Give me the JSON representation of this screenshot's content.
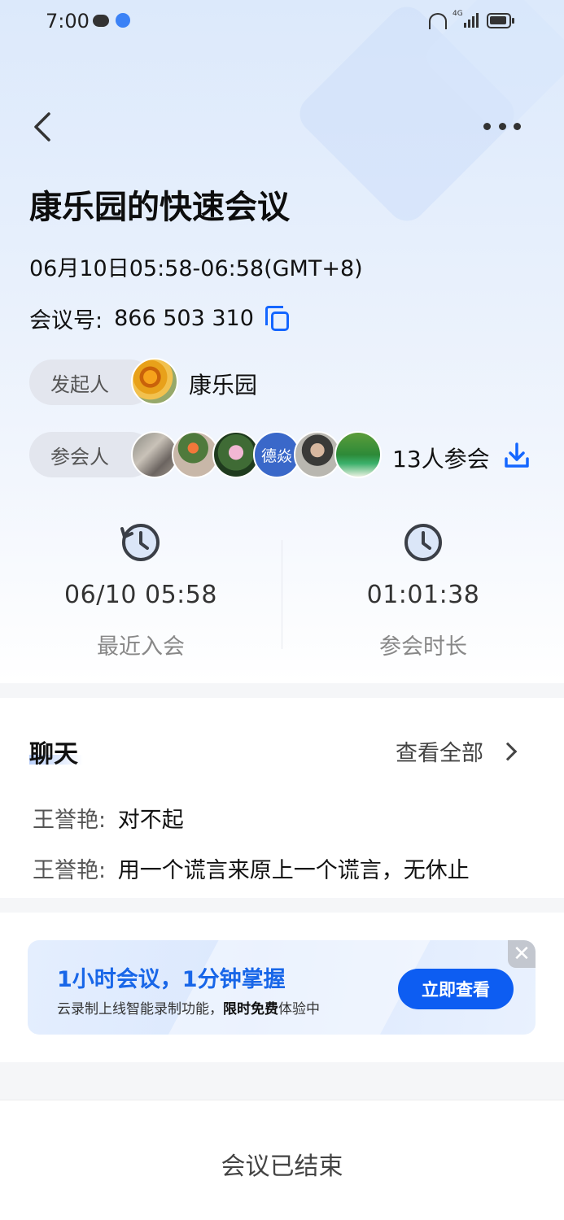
{
  "status_bar": {
    "time": "7:00",
    "network": "4G"
  },
  "header": {
    "back_icon": "chevron-left-icon",
    "more_icon": "more-horizontal-icon"
  },
  "meeting": {
    "title": "康乐园的快速会议",
    "time_range": "06月10日05:58-06:58(GMT+8)",
    "id_label": "会议号:",
    "id_value": "866 503 310",
    "host_label": "发起人",
    "host_name": "康乐园",
    "attendees_label": "参会人",
    "attendee_avatar_text": "德焱",
    "attendee_count": "13人参会"
  },
  "stats": {
    "last_join_value": "06/10 05:58",
    "last_join_label": "最近入会",
    "duration_value": "01:01:38",
    "duration_label": "参会时长"
  },
  "chat": {
    "title": "聊天",
    "view_all": "查看全部",
    "messages": [
      {
        "sender": "王誉艳:",
        "text": "对不起"
      },
      {
        "sender": "王誉艳:",
        "text": "用一个谎言来原上一个谎言，无休止"
      }
    ]
  },
  "promo": {
    "title": "1小时会议，1分钟掌握",
    "sub_before": "云录制上线智能录制功能，",
    "sub_bold": "限时免费",
    "sub_after": "体验中",
    "button": "立即查看",
    "close": "✕"
  },
  "footer": {
    "status": "会议已结束"
  },
  "colors": {
    "accent": "#1466ff",
    "button": "#0d5df2"
  }
}
